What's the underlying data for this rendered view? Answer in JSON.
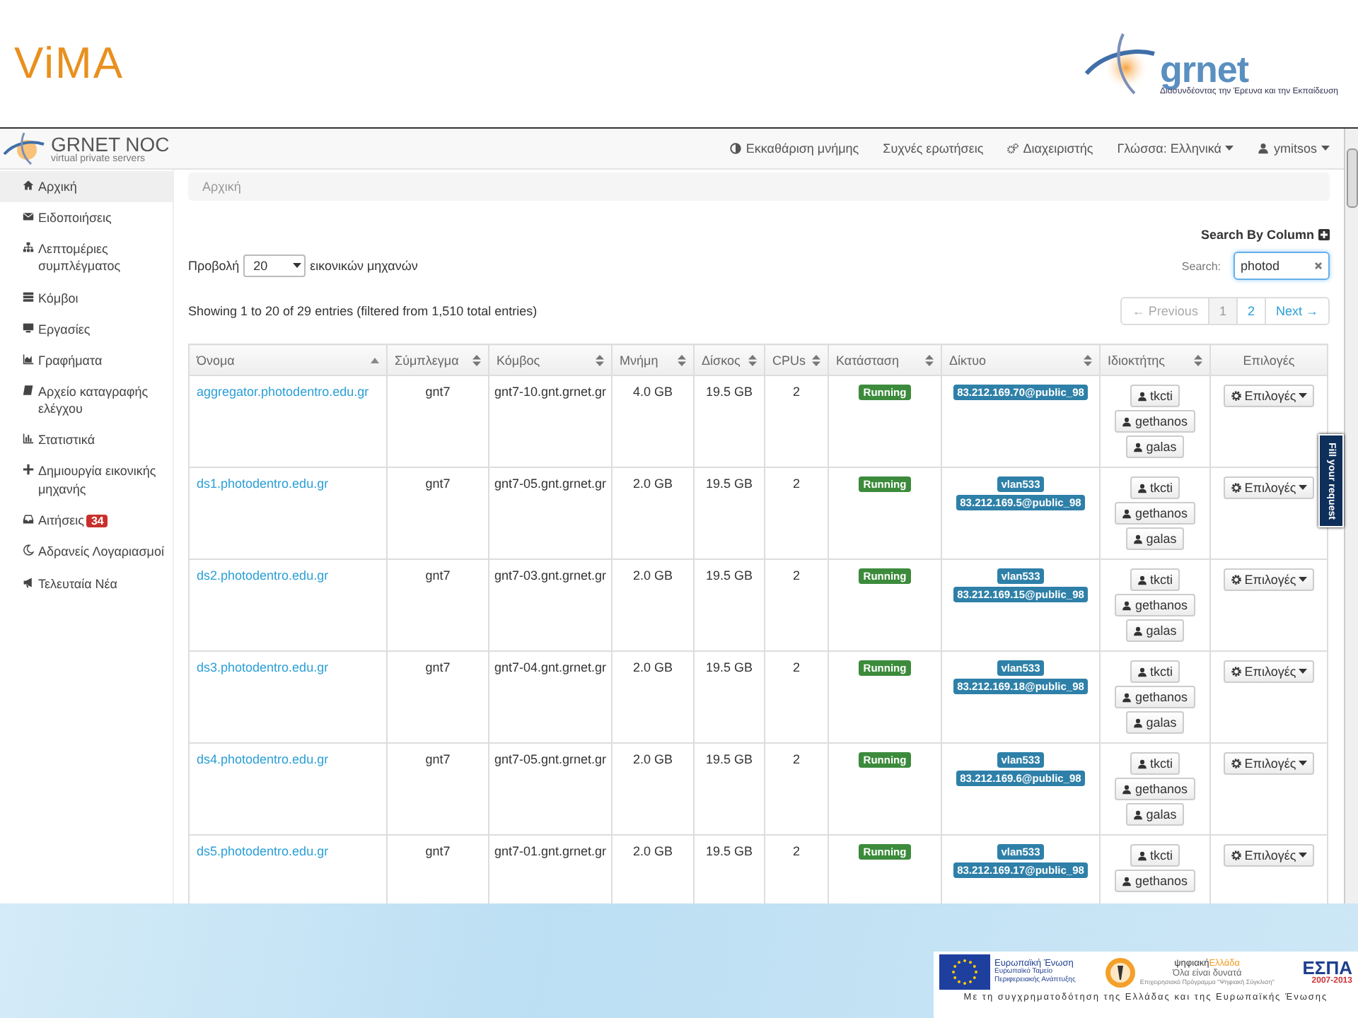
{
  "slide": {
    "title": "ViMA",
    "logo": {
      "name": "grnet",
      "tagline": "Διασυνδέοντας την Έρευνα και την Εκπαίδευση"
    }
  },
  "app": {
    "brand": {
      "name": "GRNET NOC",
      "subtitle": "virtual private servers"
    },
    "nav": [
      {
        "label": "Εκκαθάριση μνήμης",
        "dropdown": false
      },
      {
        "label": "Συχνές ερωτήσεις",
        "dropdown": false
      },
      {
        "label": "Διαχειριστής",
        "dropdown": false
      },
      {
        "label": "Γλώσσα: Ελληνικά",
        "dropdown": true
      },
      {
        "label": "ymitsos",
        "dropdown": true
      }
    ],
    "sidebar": [
      {
        "label": "Αρχική",
        "selected": true
      },
      {
        "label": "Ειδοποιήσεις",
        "selected": false
      },
      {
        "label": "Λεπτομέριες συμπλέγματος",
        "selected": false
      },
      {
        "label": "Κόμβοι",
        "selected": false
      },
      {
        "label": "Εργασίες",
        "selected": false
      },
      {
        "label": "Γραφήματα",
        "selected": false
      },
      {
        "label": "Αρχείο καταγραφής ελέγχου",
        "selected": false
      },
      {
        "label": "Στατιστικά",
        "selected": false
      },
      {
        "label": "Δημιουργία εικονικής μηχανής",
        "selected": false
      },
      {
        "label": "Αιτήσεις",
        "selected": false,
        "badge": "34"
      },
      {
        "label": "Αδρανείς Λογαριασμοί",
        "selected": false
      },
      {
        "label": "Τελευταία Νέα",
        "selected": false
      }
    ],
    "breadcrumb": "Αρχική",
    "search_by_column": "Search By Column",
    "page_length": {
      "label_before": "Προβολή",
      "value": "20",
      "label_after": "εικονικών μηχανών"
    },
    "search": {
      "label": "Search:",
      "value": "photod"
    },
    "info": "Showing 1 to 20 of 29 entries (filtered from 1,510 total entries)",
    "pagination": [
      {
        "label": "← Previous",
        "selected": false,
        "disabled": true
      },
      {
        "label": "1",
        "selected": true,
        "disabled": false
      },
      {
        "label": "2",
        "selected": false,
        "disabled": false
      },
      {
        "label": "Next →",
        "selected": false,
        "disabled": false
      }
    ],
    "table": {
      "columns": [
        {
          "label": "Όνομα",
          "sortable": true,
          "sorted_ascending": true
        },
        {
          "label": "Σύμπλεγμα",
          "sortable": true,
          "sorted_ascending": false
        },
        {
          "label": "Κόμβος",
          "sortable": true,
          "sorted_ascending": false
        },
        {
          "label": "Μνήμη",
          "sortable": true,
          "sorted_ascending": false
        },
        {
          "label": "Δίσκος",
          "sortable": true,
          "sorted_ascending": false
        },
        {
          "label": "CPUs",
          "sortable": true,
          "sorted_ascending": false
        },
        {
          "label": "Κατάσταση",
          "sortable": true,
          "sorted_ascending": false
        },
        {
          "label": "Δίκτυο",
          "sortable": true,
          "sorted_ascending": false
        },
        {
          "label": "Ιδιοκτήτης",
          "sortable": true,
          "sorted_ascending": false
        },
        {
          "label": "Επιλογές",
          "sortable": false
        }
      ],
      "rows": [
        {
          "name": "aggregator.photodentro.edu.gr",
          "cluster": "gnt7",
          "node": "gnt7-10.gnt.grnet.gr",
          "memory": "4.0 GB",
          "disk": "19.5 GB",
          "cpus": "2",
          "status": "Running",
          "networks": [
            "83.212.169.70@public_98"
          ],
          "owners": [
            "tkcti",
            "gethanos",
            "galas"
          ],
          "action": "Επιλογές"
        },
        {
          "name": "ds1.photodentro.edu.gr",
          "cluster": "gnt7",
          "node": "gnt7-05.gnt.grnet.gr",
          "memory": "2.0 GB",
          "disk": "19.5 GB",
          "cpus": "2",
          "status": "Running",
          "networks": [
            "vlan533",
            "83.212.169.5@public_98"
          ],
          "owners": [
            "tkcti",
            "gethanos",
            "galas"
          ],
          "action": "Επιλογές"
        },
        {
          "name": "ds2.photodentro.edu.gr",
          "cluster": "gnt7",
          "node": "gnt7-03.gnt.grnet.gr",
          "memory": "2.0 GB",
          "disk": "19.5 GB",
          "cpus": "2",
          "status": "Running",
          "networks": [
            "vlan533",
            "83.212.169.15@public_98"
          ],
          "owners": [
            "tkcti",
            "gethanos",
            "galas"
          ],
          "action": "Επιλογές"
        },
        {
          "name": "ds3.photodentro.edu.gr",
          "cluster": "gnt7",
          "node": "gnt7-04.gnt.grnet.gr",
          "memory": "2.0 GB",
          "disk": "19.5 GB",
          "cpus": "2",
          "status": "Running",
          "networks": [
            "vlan533",
            "83.212.169.18@public_98"
          ],
          "owners": [
            "tkcti",
            "gethanos",
            "galas"
          ],
          "action": "Επιλογές"
        },
        {
          "name": "ds4.photodentro.edu.gr",
          "cluster": "gnt7",
          "node": "gnt7-05.gnt.grnet.gr",
          "memory": "2.0 GB",
          "disk": "19.5 GB",
          "cpus": "2",
          "status": "Running",
          "networks": [
            "vlan533",
            "83.212.169.6@public_98"
          ],
          "owners": [
            "tkcti",
            "gethanos",
            "galas"
          ],
          "action": "Επιλογές"
        },
        {
          "name": "ds5.photodentro.edu.gr",
          "cluster": "gnt7",
          "node": "gnt7-01.gnt.grnet.gr",
          "memory": "2.0 GB",
          "disk": "19.5 GB",
          "cpus": "2",
          "status": "Running",
          "networks": [
            "vlan533",
            "83.212.169.17@public_98"
          ],
          "owners": [
            "tkcti",
            "gethanos"
          ],
          "action": "Επιλογές"
        }
      ]
    },
    "feedback_tab": "Fill your request"
  },
  "footer": {
    "eu": {
      "title": "Ευρωπαϊκή Ένωση",
      "fund": "Ευρωπαϊκό Ταμείο Περιφερειακής Ανάπτυξης"
    },
    "digital": {
      "name": [
        "ψηφιακή",
        "Ελλάδα"
      ],
      "slogan": "Όλα είναι δυνατά",
      "program": "Επιχειρησιακό Πρόγραμμα \"Ψηφιακή Σύγκλιση\""
    },
    "espa": {
      "name": "ΕΣΠΑ",
      "years": "2007-2013"
    },
    "credit": "Με τη συγχρηματοδότηση της Ελλάδας και της Ευρωπαϊκής Ένωσης"
  }
}
